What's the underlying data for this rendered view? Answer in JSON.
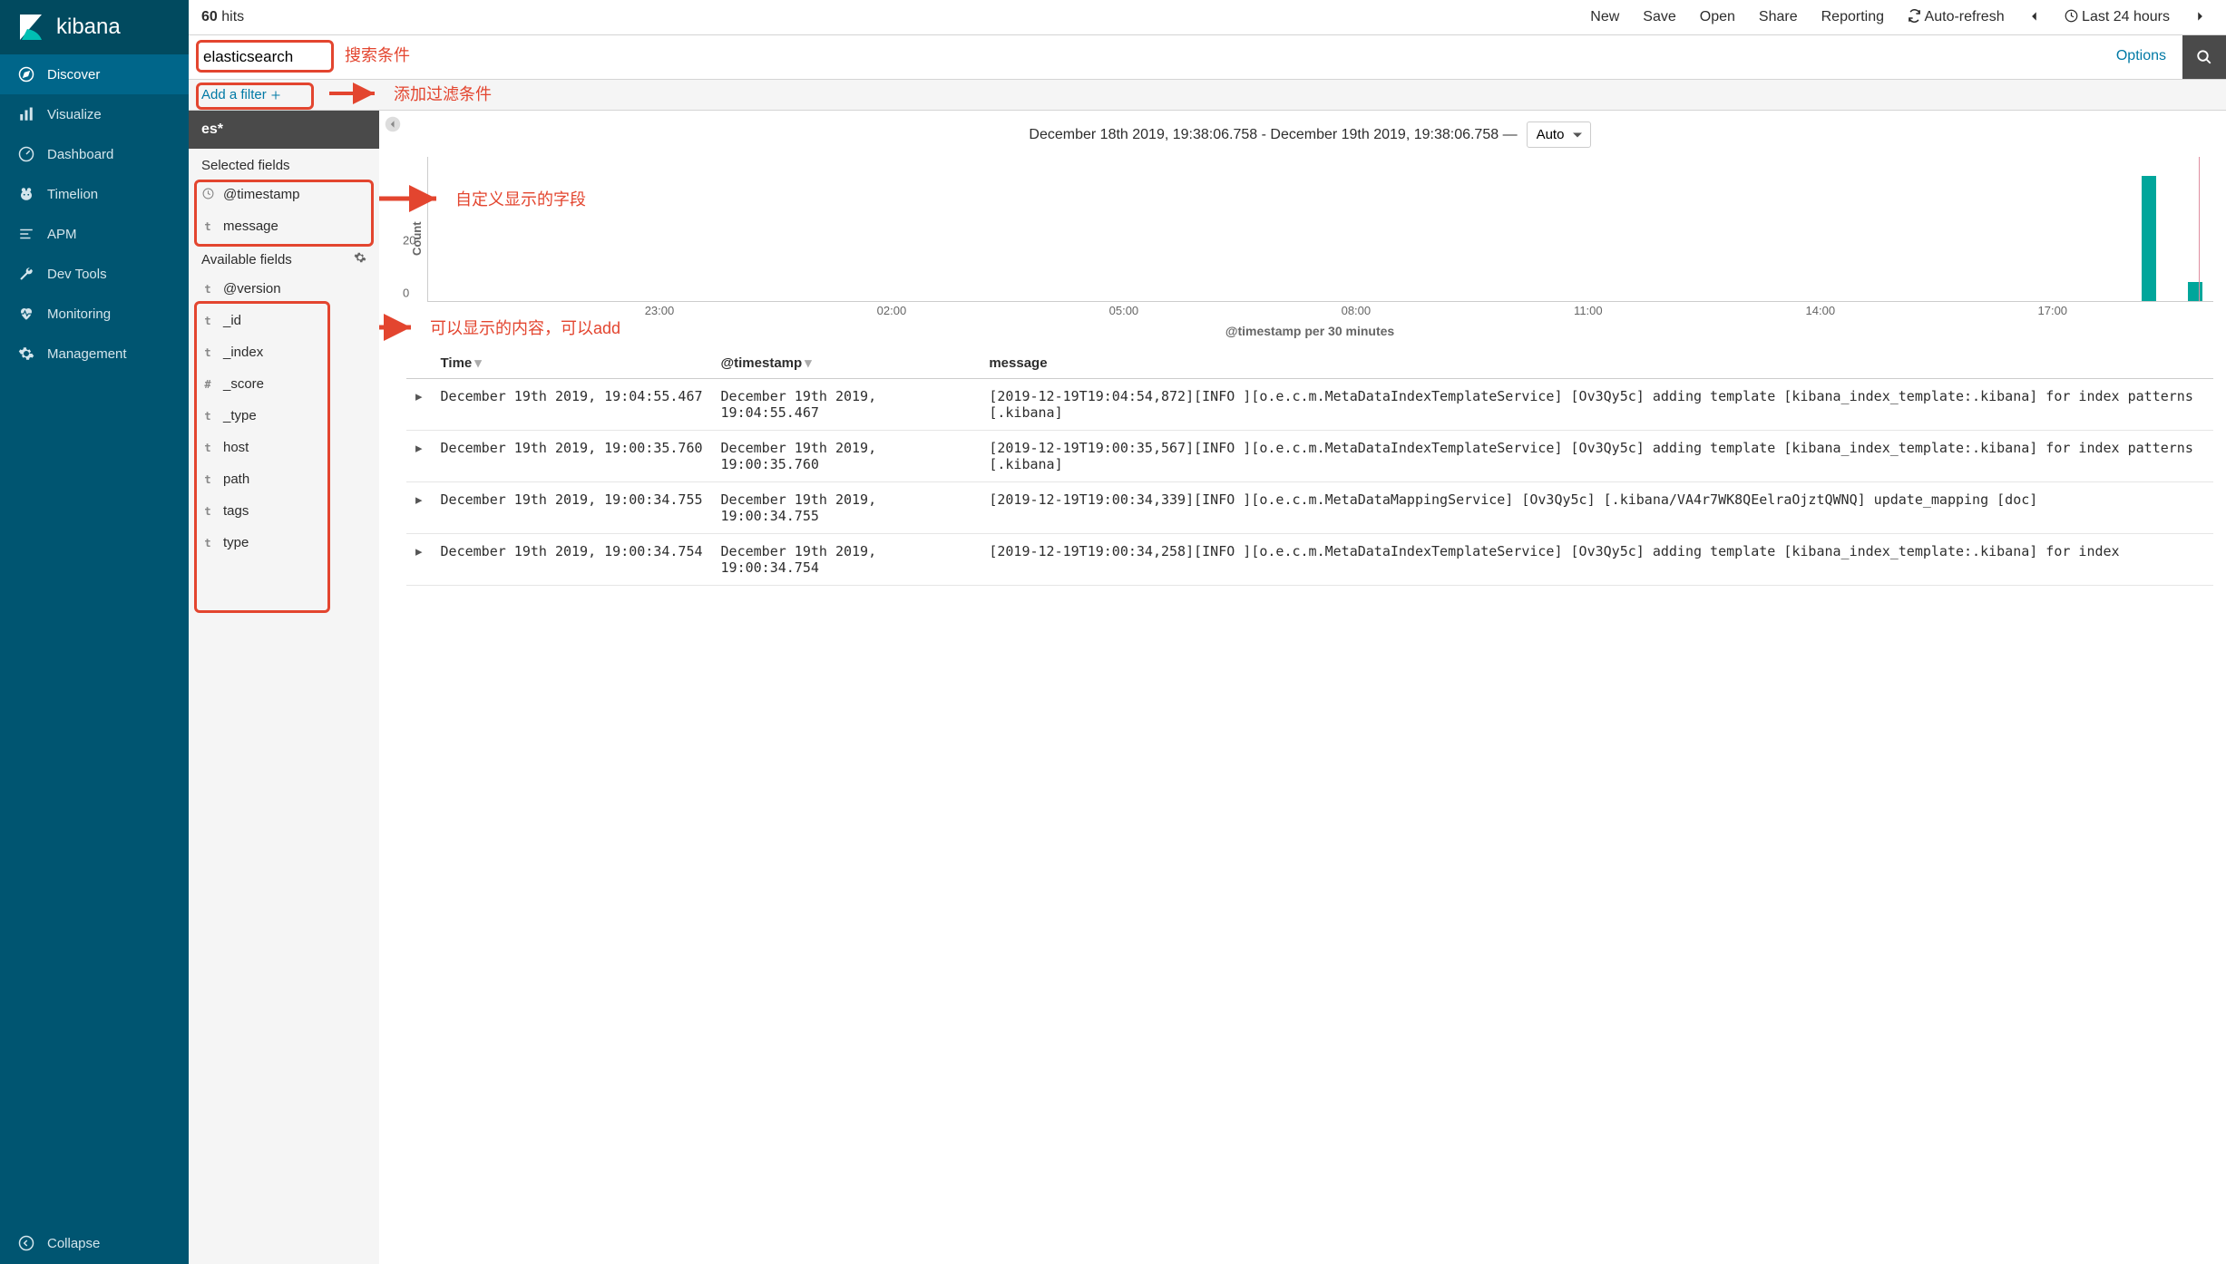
{
  "brand": {
    "name": "kibana"
  },
  "sidebar": {
    "items": [
      {
        "label": "Discover",
        "icon": "compass"
      },
      {
        "label": "Visualize",
        "icon": "bar-chart"
      },
      {
        "label": "Dashboard",
        "icon": "gauge"
      },
      {
        "label": "Timelion",
        "icon": "bear"
      },
      {
        "label": "APM",
        "icon": "lines"
      },
      {
        "label": "Dev Tools",
        "icon": "wrench"
      },
      {
        "label": "Monitoring",
        "icon": "heartbeat"
      },
      {
        "label": "Management",
        "icon": "gear"
      }
    ],
    "collapse_label": "Collapse"
  },
  "topbar": {
    "hits_count": "60",
    "hits_label": "hits",
    "links": {
      "new": "New",
      "save": "Save",
      "open": "Open",
      "share": "Share",
      "reporting": "Reporting",
      "auto_refresh": "Auto-refresh",
      "time_range": "Last 24 hours"
    }
  },
  "search": {
    "value": "elasticsearch",
    "options_label": "Options"
  },
  "filterbar": {
    "add_filter": "Add a filter"
  },
  "fields": {
    "index_pattern": "es*",
    "selected_header": "Selected fields",
    "available_header": "Available fields",
    "selected": [
      {
        "type": "clock",
        "name": "@timestamp"
      },
      {
        "type": "t",
        "name": "message"
      }
    ],
    "available": [
      {
        "type": "t",
        "name": "@version"
      },
      {
        "type": "t",
        "name": "_id"
      },
      {
        "type": "t",
        "name": "_index"
      },
      {
        "type": "#",
        "name": "_score"
      },
      {
        "type": "t",
        "name": "_type"
      },
      {
        "type": "t",
        "name": "host"
      },
      {
        "type": "t",
        "name": "path"
      },
      {
        "type": "t",
        "name": "tags"
      },
      {
        "type": "t",
        "name": "type"
      }
    ]
  },
  "results": {
    "date_range": "December 18th 2019, 19:38:06.758 - December 19th 2019, 19:38:06.758 —",
    "interval": "Auto",
    "columns": {
      "time": "Time",
      "timestamp": "@timestamp",
      "message": "message"
    },
    "rows": [
      {
        "time": "December 19th 2019, 19:04:55.467",
        "timestamp": "December 19th 2019, 19:04:55.467",
        "message": "[2019-12-19T19:04:54,872][INFO ][o.e.c.m.MetaDataIndexTemplateService] [Ov3Qy5c] adding template [kibana_index_template:.kibana] for index patterns [.kibana]"
      },
      {
        "time": "December 19th 2019, 19:00:35.760",
        "timestamp": "December 19th 2019, 19:00:35.760",
        "message": "[2019-12-19T19:00:35,567][INFO ][o.e.c.m.MetaDataIndexTemplateService] [Ov3Qy5c] adding template [kibana_index_template:.kibana] for index patterns [.kibana]"
      },
      {
        "time": "December 19th 2019, 19:00:34.755",
        "timestamp": "December 19th 2019, 19:00:34.755",
        "message": "[2019-12-19T19:00:34,339][INFO ][o.e.c.m.MetaDataMappingService] [Ov3Qy5c] [.kibana/VA4r7WK8QEelraOjztQWNQ] update_mapping [doc]"
      },
      {
        "time": "December 19th 2019, 19:00:34.754",
        "timestamp": "December 19th 2019, 19:00:34.754",
        "message": "[2019-12-19T19:00:34,258][INFO ][o.e.c.m.MetaDataIndexTemplateService] [Ov3Qy5c] adding template [kibana_index_template:.kibana] for index"
      }
    ]
  },
  "chart_data": {
    "type": "bar",
    "ylabel": "Count",
    "xlabel": "@timestamp per 30 minutes",
    "yticks": [
      0,
      20
    ],
    "xticks": [
      "23:00",
      "02:00",
      "05:00",
      "08:00",
      "11:00",
      "14:00",
      "17:00"
    ],
    "ylim": [
      0,
      60
    ],
    "bars": [
      {
        "x_pct": 96.0,
        "value": 52
      },
      {
        "x_pct": 98.6,
        "value": 8
      }
    ],
    "vline_pct": 99.2
  },
  "annotations": {
    "search": "搜索条件",
    "filter": "添加过滤条件",
    "selected_fields": "自定义显示的字段",
    "available_fields": "可以显示的内容，可以add"
  }
}
